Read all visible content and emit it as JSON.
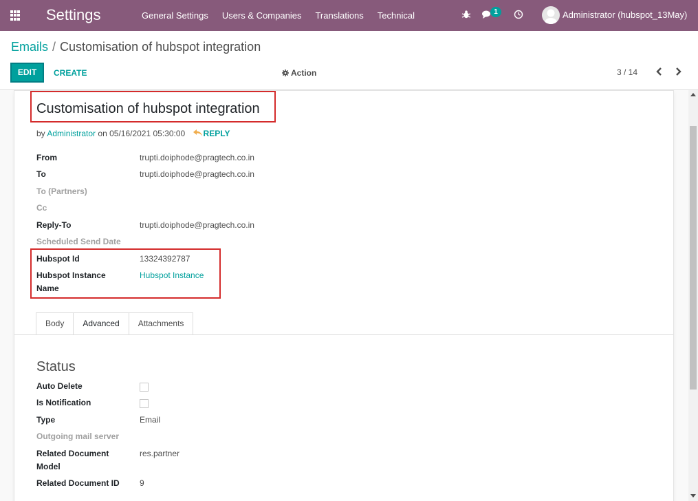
{
  "navbar": {
    "brand": "Settings",
    "menu": [
      "General Settings",
      "Users & Companies",
      "Translations",
      "Technical"
    ],
    "chat_badge": "1",
    "user": "Administrator (hubspot_13May)"
  },
  "breadcrumb": {
    "parent": "Emails",
    "separator": "/",
    "current": "Customisation of hubspot integration"
  },
  "toolbar": {
    "edit_label": "EDIT",
    "create_label": "CREATE",
    "action_label": "Action",
    "pager": "3 / 14"
  },
  "record": {
    "title": "Customisation of hubspot integration",
    "by_prefix": "by",
    "author": "Administrator",
    "on_prefix": "on",
    "date": "05/16/2021 05:30:00",
    "reply_label": "REPLY"
  },
  "fields": {
    "from_label": "From",
    "from_value": "trupti.doiphode@pragtech.co.in",
    "to_label": "To",
    "to_value": "trupti.doiphode@pragtech.co.in",
    "to_partners_label": "To (Partners)",
    "cc_label": "Cc",
    "reply_to_label": "Reply-To",
    "reply_to_value": "trupti.doiphode@pragtech.co.in",
    "scheduled_label": "Scheduled Send Date",
    "hubspot_id_label": "Hubspot Id",
    "hubspot_id_value": "13324392787",
    "hubspot_instance_label_1": "Hubspot Instance",
    "hubspot_instance_label_2": "Name",
    "hubspot_instance_value": "Hubspot Instance"
  },
  "tabs": [
    "Body",
    "Advanced",
    "Attachments"
  ],
  "status": {
    "title": "Status",
    "auto_delete_label": "Auto Delete",
    "auto_delete_checked": false,
    "is_notification_label": "Is Notification",
    "is_notification_checked": false,
    "type_label": "Type",
    "type_value": "Email",
    "mail_server_label": "Outgoing mail server",
    "related_model_label_1": "Related Document",
    "related_model_label_2": "Model",
    "related_model_value": "res.partner",
    "related_id_label": "Related Document ID",
    "related_id_value": "9"
  },
  "colors": {
    "navbar": "#875a7b",
    "accent": "#00a09d",
    "highlight": "#d42b2b"
  }
}
